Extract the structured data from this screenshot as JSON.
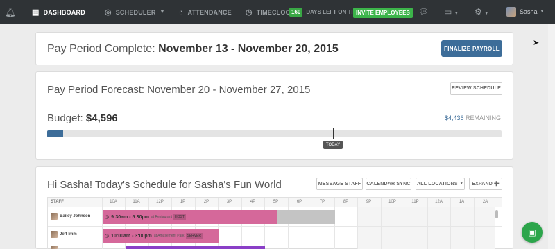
{
  "nav": {
    "items": [
      {
        "label": "DASHBOARD",
        "icon": "dashboard-icon"
      },
      {
        "label": "SCHEDULER",
        "icon": "scheduler-icon"
      },
      {
        "label": "ATTENDANCE",
        "icon": "attendance-icon"
      },
      {
        "label": "TIMECLOCK",
        "icon": "timeclock-icon"
      }
    ],
    "trial_days": "160",
    "trial_text": "DAYS LEFT ON TRIAL",
    "invite_label": "INVITE EMPLOYEES",
    "user_name": "Sasha"
  },
  "payroll": {
    "title_prefix": "Pay Period Complete:",
    "title_range": "November 13 - November 20, 2015",
    "finalize_label": "FINALIZE PAYROLL"
  },
  "forecast": {
    "title": "Pay Period Forecast: November 20 - November 27, 2015",
    "review_label": "REVIEW SCHEDULE",
    "budget_label": "Budget:",
    "budget_value": "$4,596",
    "remaining_amount": "$4,436",
    "remaining_label": "REMAINING",
    "spent_fraction": 0.035,
    "today_label": "TODAY"
  },
  "schedule": {
    "title": "Hi Sasha! Today's Schedule for Sasha's Fun World",
    "buttons": {
      "message": "MESSAGE STAFF",
      "calendar": "CALENDAR SYNC",
      "locations": "ALL LOCATIONS",
      "expand": "EXPAND"
    },
    "staff_header": "STAFF",
    "hours": [
      "10A",
      "11A",
      "12P",
      "1P",
      "2P",
      "3P",
      "4P",
      "5P",
      "6P",
      "7P",
      "8P",
      "9P",
      "10P",
      "11P",
      "12A",
      "1A",
      "2A"
    ],
    "rows": [
      {
        "name": "Bailey Johnson",
        "time": "9:30am - 5:30pm",
        "loc": "at Restaurant",
        "position": "HOST"
      },
      {
        "name": "Jeff Imm",
        "time": "10:00am - 3:00pm",
        "loc": "at Amusement Park",
        "position": "SERVER"
      }
    ]
  },
  "colors": {
    "topbar": "#2f3336",
    "primary": "#3d6d99",
    "green": "#3cb44a",
    "shift_pink": "#d5689a",
    "shift_gray": "#c4c4c4",
    "shift_purple": "#8a3fc7"
  }
}
